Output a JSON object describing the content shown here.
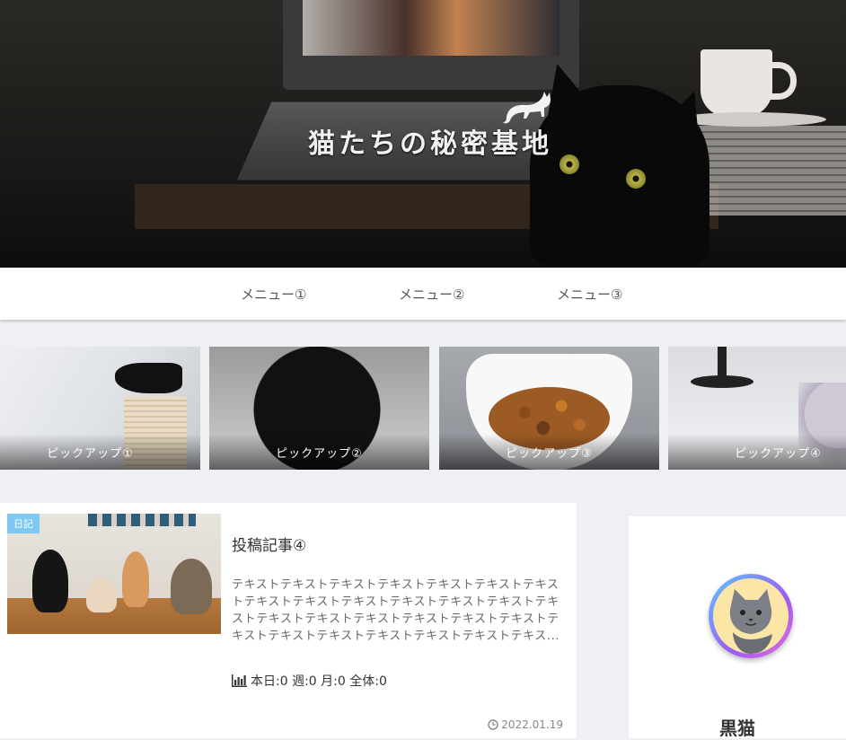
{
  "header": {
    "site_title": "猫たちの秘密基地"
  },
  "nav": {
    "items": [
      "メニュー①",
      "メニュー②",
      "メニュー③"
    ]
  },
  "pickups": [
    "ピックアップ①",
    "ピックアップ②",
    "ピックアップ③",
    "ピックアップ④"
  ],
  "post": {
    "category": "日記",
    "title": "投稿記事④",
    "excerpt": "テキストテキストテキストテキストテキストテキストテキストテキストテキストテキストテキストテキストテキストテキストテキストテキストテキストテキストテキストテキストテキストテキストテキストテキストテキストテキストテキス...",
    "pv": "本日:0 週:0 月:0 全体:0",
    "date": "2022.01.19",
    "icons": {
      "pv": "bar-chart-icon",
      "date": "clock-icon"
    }
  },
  "sidebar": {
    "username": "黒猫"
  }
}
